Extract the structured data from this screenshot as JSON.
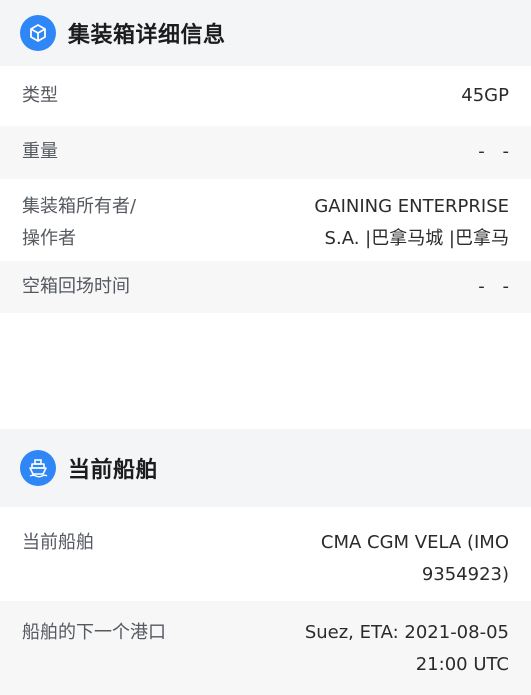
{
  "container_section": {
    "title": "集装箱详细信息",
    "icon": "container-box-icon",
    "accent_color": "#2f86f6",
    "rows": [
      {
        "label": "类型",
        "value": "45GP"
      },
      {
        "label": "重量",
        "value": "- -"
      },
      {
        "label_line1": "集装箱所有者/",
        "label_line2": "操作者",
        "value_line1": "GAINING ENTERPRISE",
        "value_line2": "S.A. |巴拿马城 |巴拿马"
      },
      {
        "label": "空箱回场时间",
        "value": "- -"
      }
    ]
  },
  "vessel_section": {
    "title": "当前船舶",
    "icon": "ship-icon",
    "rows": [
      {
        "label": "当前船舶",
        "value_line1": "CMA CGM VELA (IMO",
        "value_line2": "9354923)"
      },
      {
        "label": "船舶的下一个港口",
        "value_line1": "Suez, ETA: 2021-08-05",
        "value_line2": "21:00 UTC"
      }
    ]
  }
}
